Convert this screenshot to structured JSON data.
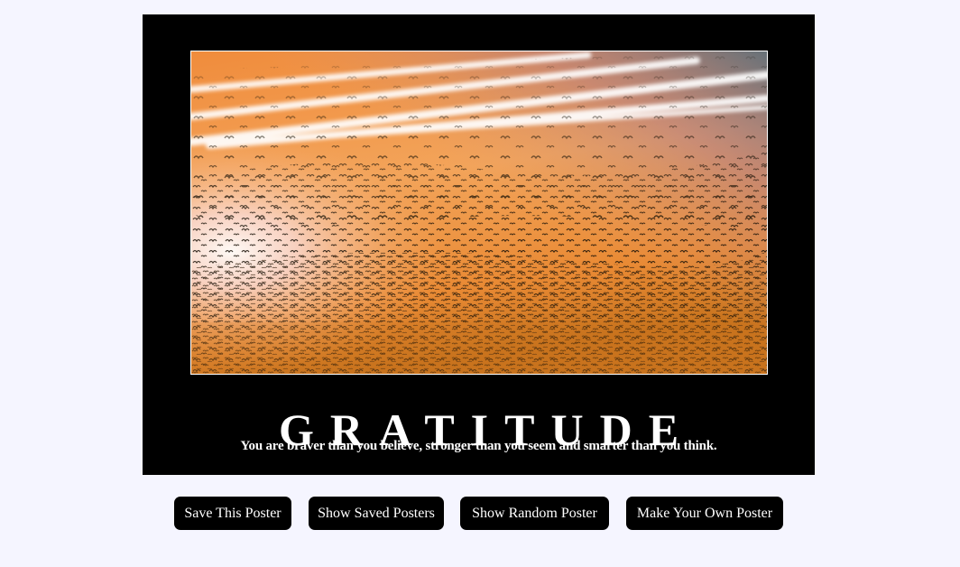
{
  "poster": {
    "title": "GRATITUDE",
    "quote": "You are braver than you believe, stronger than you seem and smarter than you think.",
    "image": {
      "subject": "flock of birds flying across an orange sunset sky with white contrails"
    }
  },
  "buttons": {
    "save": "Save This Poster",
    "show_saved": "Show Saved Posters",
    "show_random": "Show Random Poster",
    "make_own": "Make Your Own Poster"
  },
  "colors": {
    "page_background": "#f5f5ff",
    "poster_background": "#000000",
    "button_background": "#000000",
    "button_text": "#ffffff"
  }
}
